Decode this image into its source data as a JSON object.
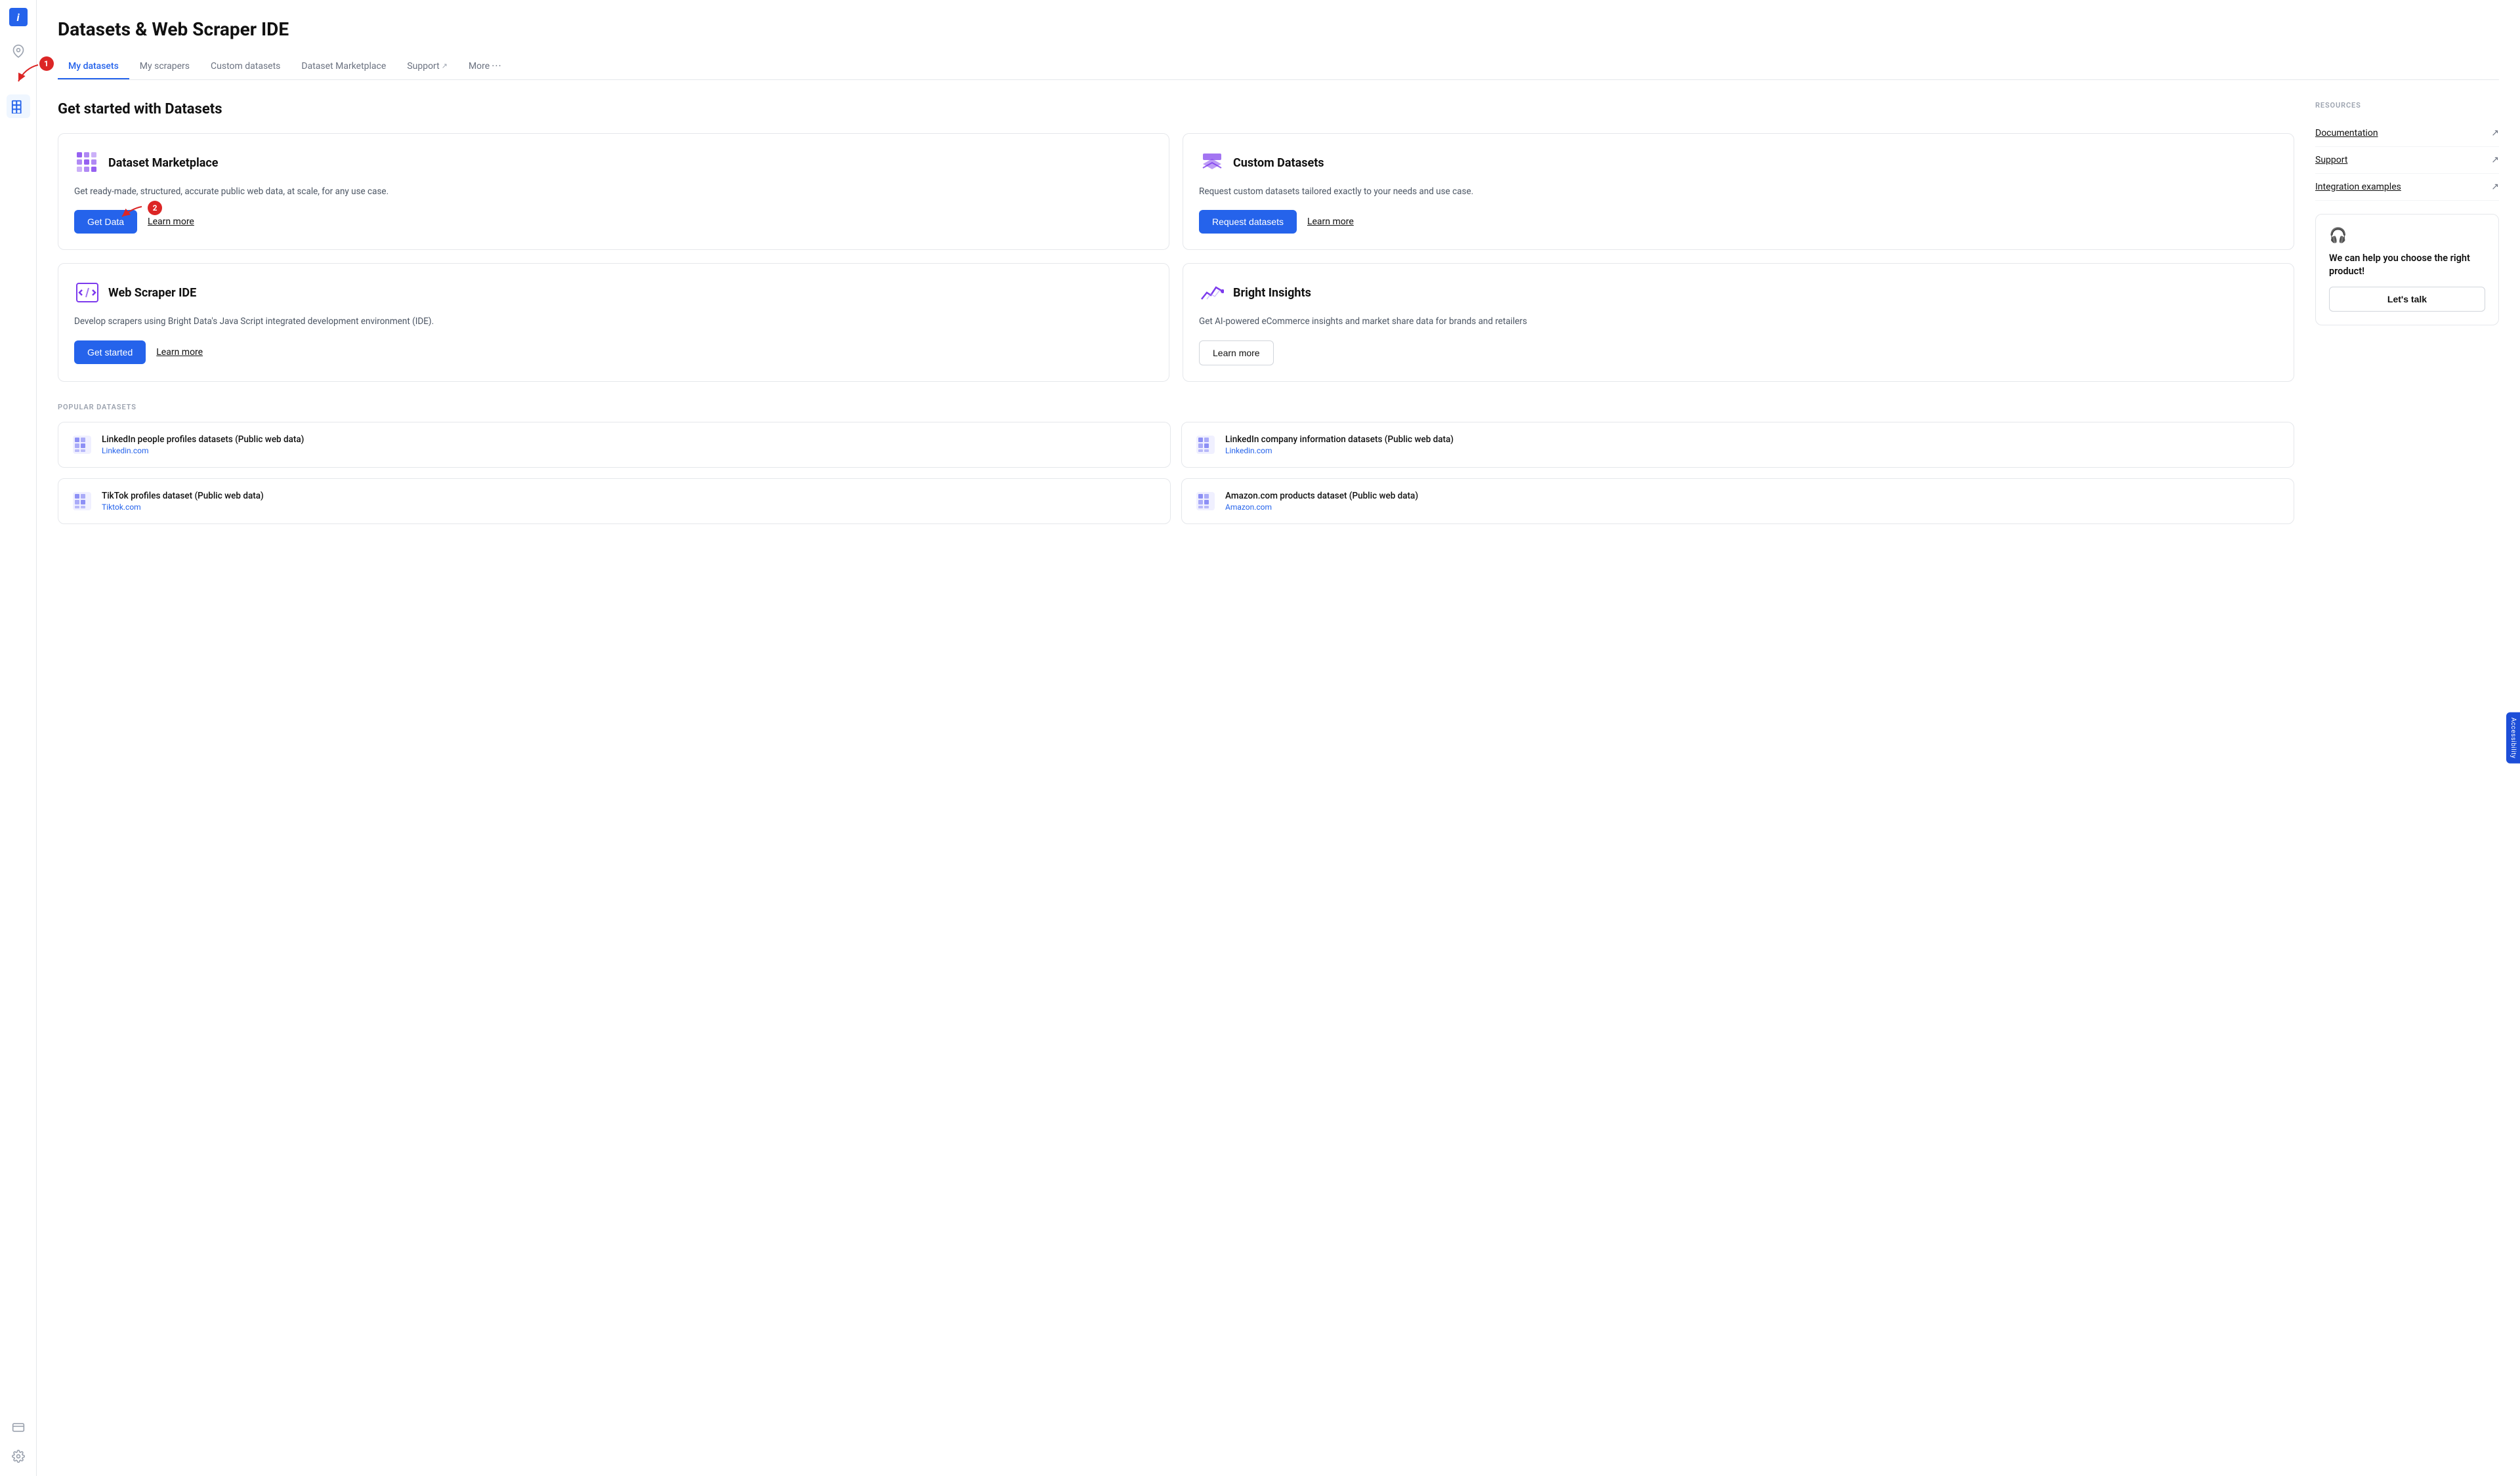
{
  "page": {
    "title": "Datasets & Web Scraper IDE"
  },
  "tabs": [
    {
      "id": "my-datasets",
      "label": "My datasets",
      "active": true,
      "external": false
    },
    {
      "id": "my-scrapers",
      "label": "My scrapers",
      "active": false,
      "external": false
    },
    {
      "id": "custom-datasets",
      "label": "Custom datasets",
      "active": false,
      "external": false
    },
    {
      "id": "dataset-marketplace",
      "label": "Dataset Marketplace",
      "active": false,
      "external": false
    },
    {
      "id": "support",
      "label": "Support",
      "active": false,
      "external": true
    },
    {
      "id": "more",
      "label": "More",
      "active": false,
      "external": false
    }
  ],
  "section": {
    "title": "Get started with Datasets"
  },
  "cards": [
    {
      "id": "dataset-marketplace",
      "title": "Dataset Marketplace",
      "description": "Get ready-made, structured, accurate public web data, at scale, for any use case.",
      "primary_btn": "Get Data",
      "learn_more": "Learn more"
    },
    {
      "id": "custom-datasets",
      "title": "Custom Datasets",
      "description": "Request custom datasets tailored exactly to your needs and use case.",
      "primary_btn": "Request datasets",
      "learn_more": "Learn more"
    },
    {
      "id": "web-scraper-ide",
      "title": "Web Scraper IDE",
      "description": "Develop scrapers using Bright Data's Java Script integrated development environment (IDE).",
      "primary_btn": "Get started",
      "learn_more": "Learn more"
    },
    {
      "id": "bright-insights",
      "title": "Bright Insights",
      "description": "Get AI-powered eCommerce insights and market share data for brands and retailers",
      "primary_btn": null,
      "secondary_btn": "Learn more"
    }
  ],
  "popular_datasets": {
    "label": "POPULAR DATASETS",
    "items": [
      {
        "name": "LinkedIn people profiles datasets (Public web data)",
        "source": "Linkedin.com"
      },
      {
        "name": "LinkedIn company information datasets (Public web data)",
        "source": "Linkedin.com"
      },
      {
        "name": "TikTok profiles dataset (Public web data)",
        "source": "Tiktok.com"
      },
      {
        "name": "Amazon.com products dataset (Public web data)",
        "source": "Amazon.com"
      }
    ]
  },
  "resources": {
    "label": "RESOURCES",
    "links": [
      {
        "text": "Documentation",
        "icon": "↗"
      },
      {
        "text": "Support",
        "icon": "↗"
      },
      {
        "text": "Integration examples",
        "icon": "↗"
      }
    ],
    "help_box": {
      "text": "We can help you choose the right product!",
      "btn": "Let's talk"
    }
  },
  "accessibility_tab": "Accessibility",
  "sidebar": {
    "icons": [
      {
        "id": "info",
        "label": "info-icon"
      },
      {
        "id": "location",
        "label": "location-icon"
      },
      {
        "id": "datasets",
        "label": "datasets-icon",
        "active": true
      },
      {
        "id": "billing",
        "label": "billing-icon"
      },
      {
        "id": "settings",
        "label": "settings-icon"
      }
    ]
  }
}
